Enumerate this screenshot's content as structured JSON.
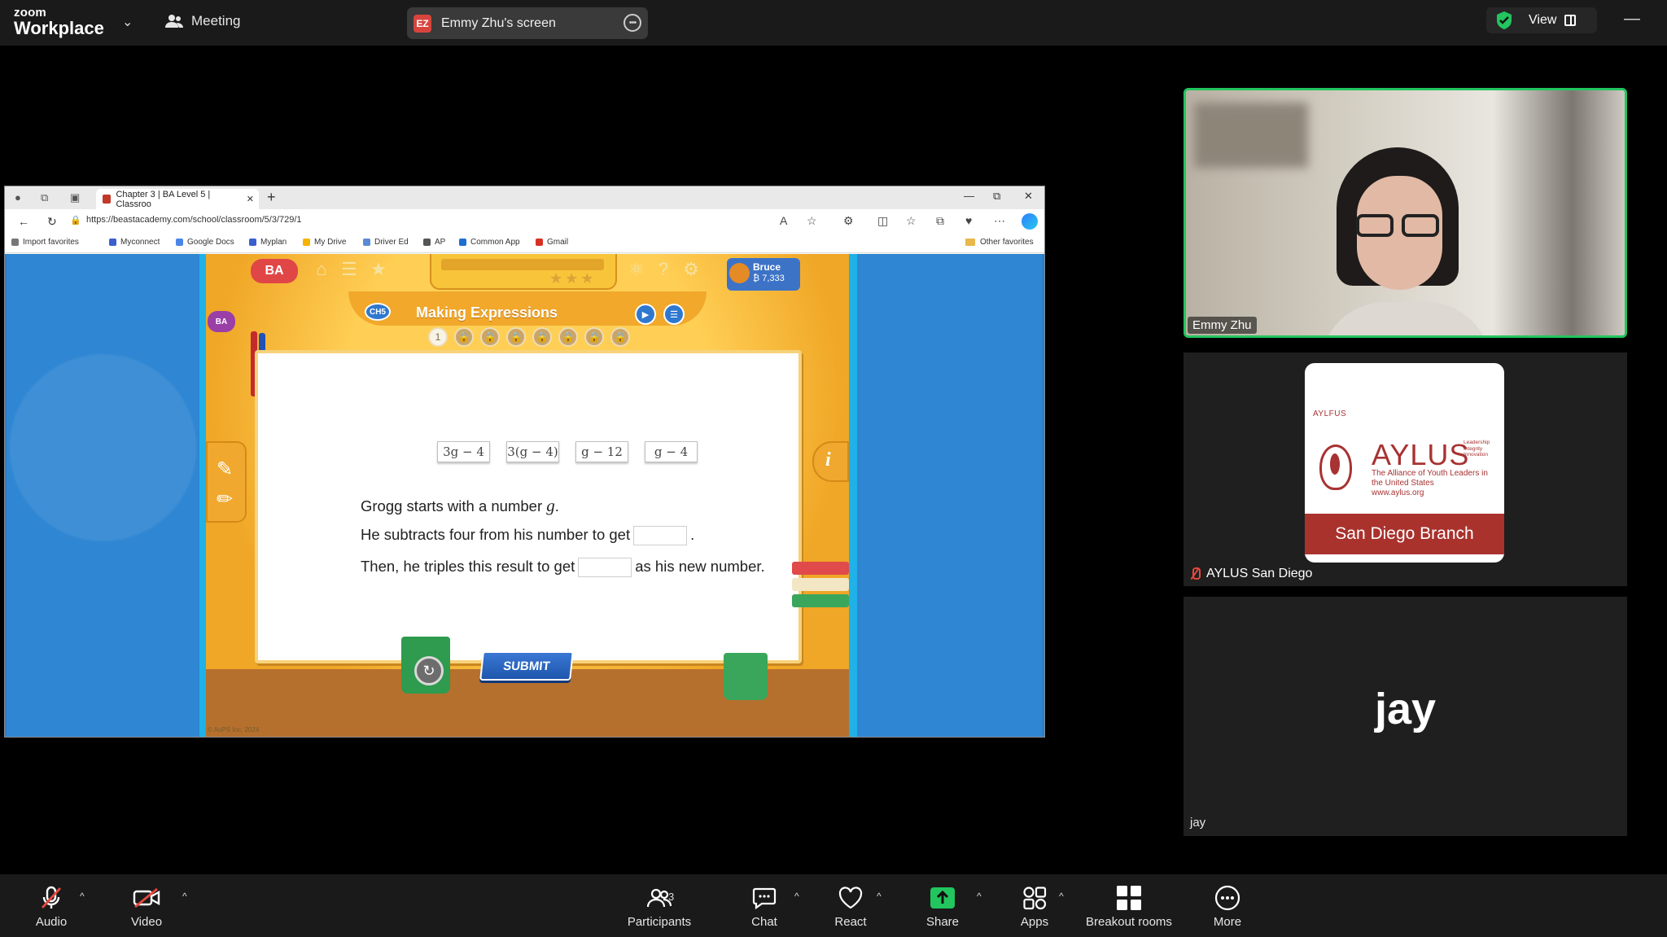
{
  "topbar": {
    "brand_line1": "zoom",
    "brand_line2": "Workplace",
    "meeting_label": "Meeting",
    "share_initials": "EZ",
    "share_label": "Emmy Zhu's screen",
    "view_label": "View"
  },
  "browser": {
    "tab_title": "Chapter 3 | BA Level 5 | Classroo",
    "url": "https://beastacademy.com/school/classroom/5/3/729/1",
    "favorites": [
      "Import favorites",
      "Myconnect",
      "Google Docs",
      "Myplan",
      "My Drive",
      "Driver Ed",
      "AP",
      "Common App",
      "Gmail"
    ],
    "other_favorites": "Other favorites"
  },
  "game": {
    "logo": "BA",
    "chapter_chip": "CH5",
    "title": "Making Expressions",
    "steps": [
      "1",
      "",
      "",
      "",
      "",
      "",
      "",
      ""
    ],
    "user_name": "Bruce",
    "user_points": "₿ 7,333",
    "left_tag": "BA",
    "choices": [
      "3g − 4",
      "3(g − 4)",
      "g − 12",
      "g − 4"
    ],
    "line1_pre": "Grogg starts with a number",
    "line1_var": "g",
    "line1_post": ".",
    "line2_pre": "He subtracts four from his number to get",
    "line2_post": ".",
    "line3_pre": "Then, he triples this result to get",
    "line3_post": "as his new number.",
    "submit": "SUBMIT",
    "info": "i",
    "copyright": "© AoPS Inc. 2024"
  },
  "participants": {
    "emmy": {
      "name": "Emmy Zhu"
    },
    "aylus": {
      "name": "AYLUS San Diego",
      "card_small": "AYLFUS",
      "card_big": "AYLUS",
      "card_motto": "Leadership Integrity Innovation",
      "card_sub": "The Alliance of Youth Leaders in the United States",
      "card_site": "www.aylus.org",
      "card_band": "San Diego Branch"
    },
    "jay": {
      "big": "jay",
      "name": "jay"
    }
  },
  "toolbar": {
    "audio": "Audio",
    "video": "Video",
    "participants": "Participants",
    "participants_count": "3",
    "chat": "Chat",
    "react": "React",
    "share": "Share",
    "apps": "Apps",
    "breakout": "Breakout rooms",
    "more": "More"
  },
  "colors": {
    "accent_green": "#22c55e",
    "share_green": "#22c55e",
    "mute_red": "#e5483f",
    "aylus_red": "#a9322d"
  }
}
